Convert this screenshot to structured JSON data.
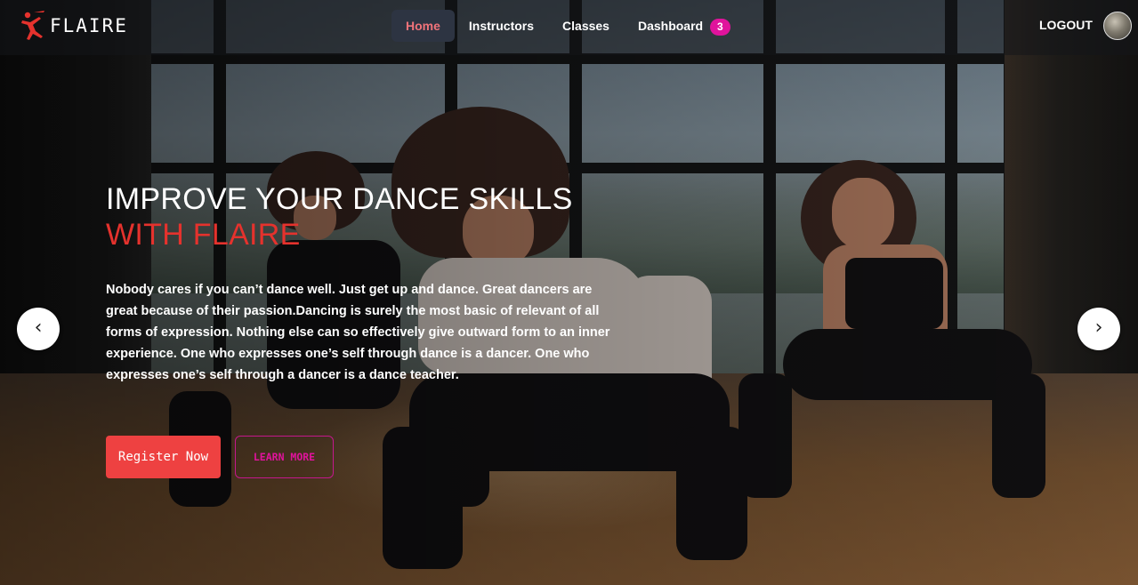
{
  "brand": {
    "name": "FLAIRE",
    "logo_icon": "dancer-logo-icon",
    "accent": "#e5322d"
  },
  "nav": {
    "links": [
      {
        "label": "Home",
        "active": true
      },
      {
        "label": "Instructors",
        "active": false
      },
      {
        "label": "Classes",
        "active": false
      },
      {
        "label": "Dashboard",
        "active": false,
        "badge": "3"
      }
    ],
    "logout_label": "LOGOUT"
  },
  "hero": {
    "title_line1": "IMPROVE YOUR DANCE SKILLS",
    "title_line2": "WITH FLAIRE",
    "description": "Nobody cares if you can’t dance well. Just get up and dance. Great dancers are great because of their passion.Dancing is surely the most basic of relevant of all forms of expression. Nothing else can so effectively give outward form to an inner experience. One who expresses one’s self through dance is a dancer. One who expresses one’s self through a dancer is a dance teacher.",
    "primary_button": "Register Now",
    "secondary_button": "LEARN MORE"
  },
  "carousel": {
    "prev_glyph": "‹",
    "next_glyph": "›"
  },
  "colors": {
    "primary": "#ee4141",
    "badge": "#e0139c",
    "active_nav_text": "#f0737a",
    "active_nav_bg": "#2d3442"
  }
}
